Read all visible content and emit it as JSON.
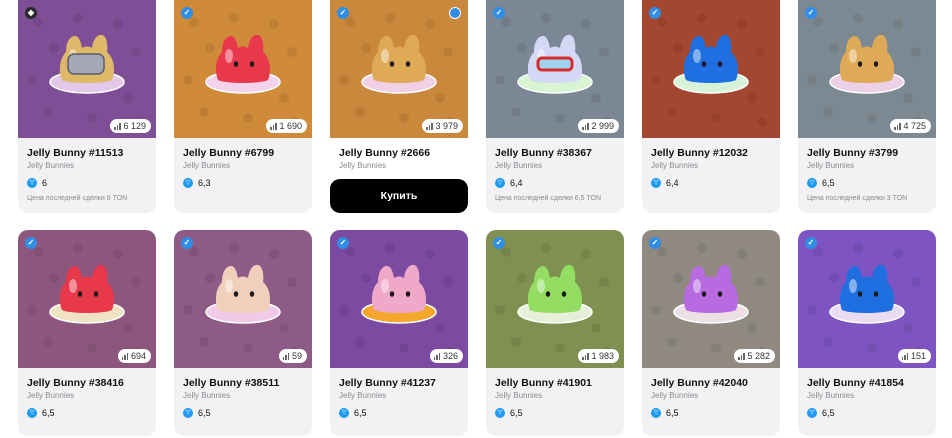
{
  "buy_label": "Купить",
  "cards": [
    {
      "title": "Jelly Bunny #11513",
      "collection": "Jelly Bunnies",
      "price": "6",
      "last_sale": "Цена последней сделки 6 TON",
      "count": "6 129",
      "bg": "#7e4f96",
      "jelly": "#e0b86a",
      "plate": "#e3c8e9",
      "corner": "marketplace-icon",
      "accessory": "skull-mask"
    },
    {
      "title": "Jelly Bunny #6799",
      "collection": "Jelly Bunnies",
      "price": "6,3",
      "count": "1 690",
      "bg": "#cf8a3a",
      "jelly": "#e8384b",
      "plate": "#f3d3ea",
      "corner": "verified-icon"
    },
    {
      "title": "Jelly Bunny #2666",
      "collection": "Jelly Bunnies",
      "price": "",
      "count": "3 979",
      "bg": "#c9883b",
      "jelly": "#deaa57",
      "plate": "#f1d0e5",
      "corner": "verified-icon",
      "buy": true
    },
    {
      "title": "Jelly Bunny #38367",
      "collection": "Jelly Bunnies",
      "price": "6,4",
      "last_sale": "Цена последней сделки 6,5 TON",
      "count": "2 999",
      "bg": "#7b8794",
      "jelly": "#d5d8f5",
      "plate": "#d7f5d0",
      "corner": "verified-icon",
      "accessory": "goggles"
    },
    {
      "title": "Jelly Bunny #12032",
      "collection": "Jelly Bunnies",
      "price": "6,4",
      "count": "",
      "bg": "#a44730",
      "jelly": "#1f6fe0",
      "plate": "#d6f3da",
      "corner": "verified-icon"
    },
    {
      "title": "Jelly Bunny #3799",
      "collection": "Jelly Bunnies",
      "price": "6,5",
      "last_sale": "Цена последней сделки 3 TON",
      "count": "4 725",
      "bg": "#7d8992",
      "jelly": "#deaa57",
      "plate": "#ecd0e7",
      "corner": "verified-icon"
    },
    {
      "title": "Jelly Bunny #38416",
      "collection": "Jelly Bunnies",
      "price": "6,5",
      "count": "694",
      "bg": "#8d577d",
      "jelly": "#e8384b",
      "plate": "#efe3c1",
      "corner": "verified-icon"
    },
    {
      "title": "Jelly Bunny #38511",
      "collection": "Jelly Bunnies",
      "price": "6,5",
      "count": "59",
      "bg": "#8e5a86",
      "jelly": "#f0cfbd",
      "plate": "#f0cae6",
      "corner": "verified-icon"
    },
    {
      "title": "Jelly Bunny #41237",
      "collection": "Jelly Bunnies",
      "price": "6,5",
      "count": "326",
      "bg": "#7c4aa1",
      "jelly": "#f0a8c9",
      "plate": "#f4a62d",
      "corner": "verified-icon"
    },
    {
      "title": "Jelly Bunny #41901",
      "collection": "Jelly Bunnies",
      "price": "6,5",
      "count": "1 983",
      "bg": "#7f9050",
      "jelly": "#92dd62",
      "plate": "#e7efd8",
      "corner": "verified-icon"
    },
    {
      "title": "Jelly Bunny #42040",
      "collection": "Jelly Bunnies",
      "price": "6,5",
      "count": "5 282",
      "bg": "#8f8980",
      "jelly": "#b86be0",
      "plate": "#ece0e4",
      "corner": "verified-icon"
    },
    {
      "title": "Jelly Bunny #41854",
      "collection": "Jelly Bunnies",
      "price": "6,5",
      "count": "151",
      "bg": "#7d54c2",
      "jelly": "#1f6fe0",
      "plate": "#e9dcf1",
      "corner": "verified-icon"
    }
  ]
}
